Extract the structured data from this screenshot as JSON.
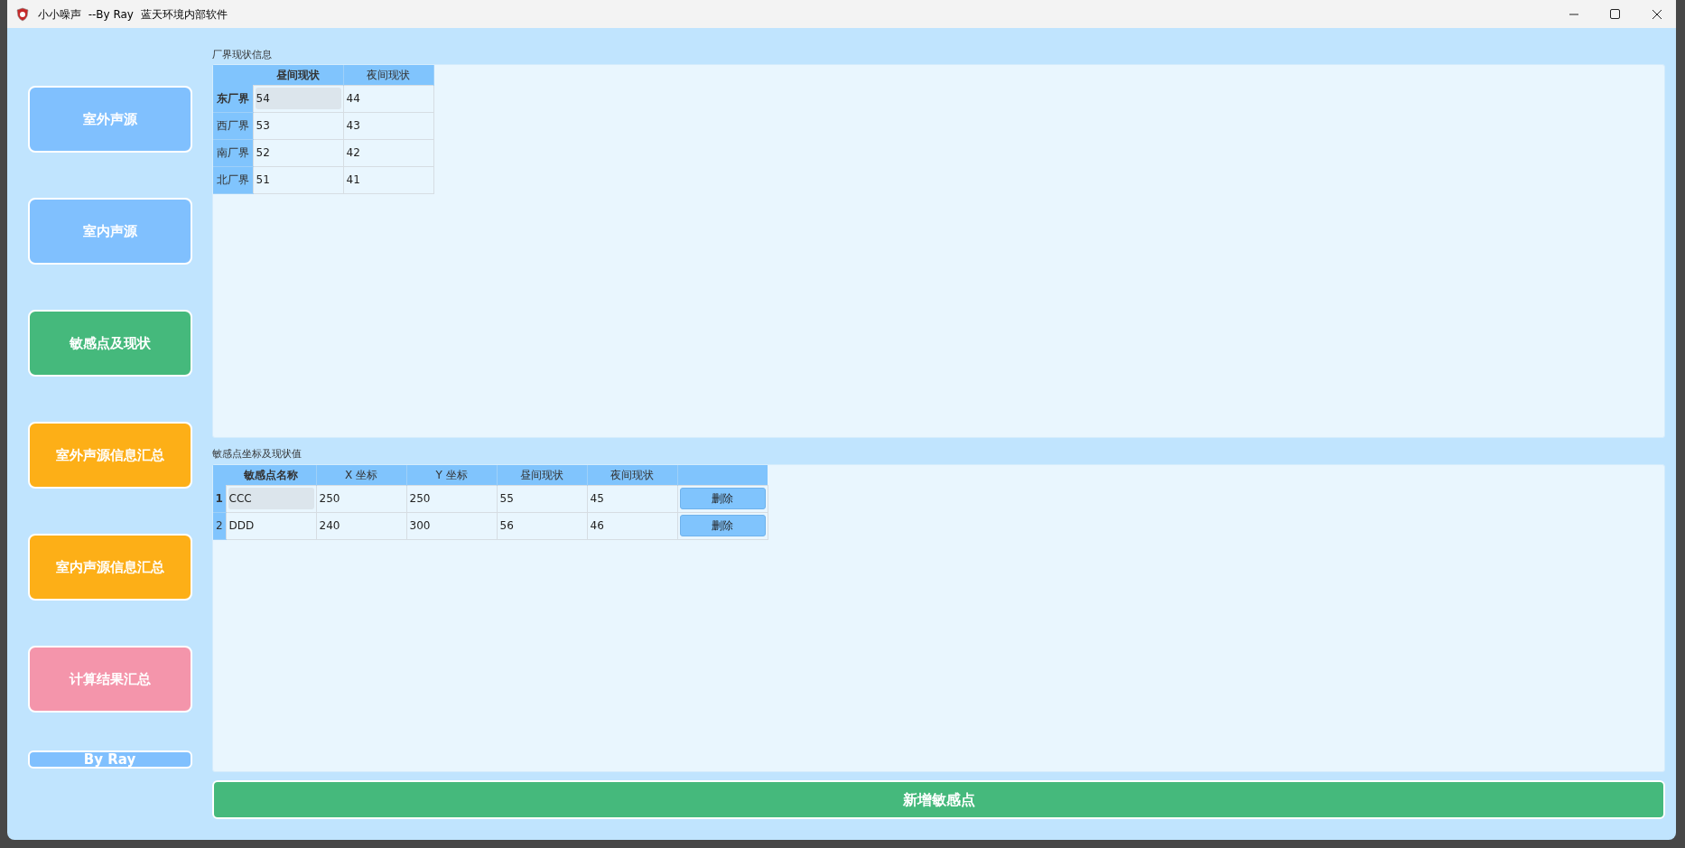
{
  "window": {
    "title": "小小噪声  --By Ray  蓝天环境内部软件"
  },
  "sidebar": {
    "items": [
      {
        "label": "室外声源",
        "color": "#80c0fe"
      },
      {
        "label": "室内声源",
        "color": "#80c0fe"
      },
      {
        "label": "敏感点及现状",
        "color": "#45b97c"
      },
      {
        "label": "室外声源信息汇总",
        "color": "#fdaf17"
      },
      {
        "label": "室内声源信息汇总",
        "color": "#fdaf17"
      },
      {
        "label": "计算结果汇总",
        "color": "#f495ab"
      }
    ],
    "footer": "By Ray"
  },
  "boundary_table": {
    "title": "厂界现状信息",
    "columns": [
      {
        "label": "昼间现状",
        "selected": true
      },
      {
        "label": "夜间现状",
        "selected": false
      }
    ],
    "rows": [
      {
        "header": "东厂界",
        "selected": true,
        "cells": [
          {
            "text": "54",
            "selected": true
          },
          {
            "text": "44",
            "selected": false
          }
        ]
      },
      {
        "header": "西厂界",
        "selected": false,
        "cells": [
          {
            "text": "53",
            "selected": false
          },
          {
            "text": "43",
            "selected": false
          }
        ]
      },
      {
        "header": "南厂界",
        "selected": false,
        "cells": [
          {
            "text": "52",
            "selected": false
          },
          {
            "text": "42",
            "selected": false
          }
        ]
      },
      {
        "header": "北厂界",
        "selected": false,
        "cells": [
          {
            "text": "51",
            "selected": false
          },
          {
            "text": "41",
            "selected": false
          }
        ]
      }
    ]
  },
  "sensitive_table": {
    "title": "敏感点坐标及现状值",
    "columns": [
      {
        "label": "敏感点名称",
        "selected": true
      },
      {
        "label": "X 坐标",
        "selected": false
      },
      {
        "label": "Y 坐标",
        "selected": false
      },
      {
        "label": "昼间现状",
        "selected": false
      },
      {
        "label": "夜间现状",
        "selected": false
      }
    ],
    "rows": [
      {
        "header": "1",
        "selected": true,
        "cells": [
          {
            "text": "CCC",
            "selected": true
          },
          {
            "text": "250",
            "selected": false
          },
          {
            "text": "250",
            "selected": false
          },
          {
            "text": "55",
            "selected": false
          },
          {
            "text": "45",
            "selected": false
          }
        ],
        "action": "删除"
      },
      {
        "header": "2",
        "selected": false,
        "cells": [
          {
            "text": "DDD",
            "selected": false
          },
          {
            "text": "240",
            "selected": false
          },
          {
            "text": "300",
            "selected": false
          },
          {
            "text": "56",
            "selected": false
          },
          {
            "text": "46",
            "selected": false
          }
        ],
        "action": "删除"
      }
    ]
  },
  "add_button": "新增敏感点"
}
